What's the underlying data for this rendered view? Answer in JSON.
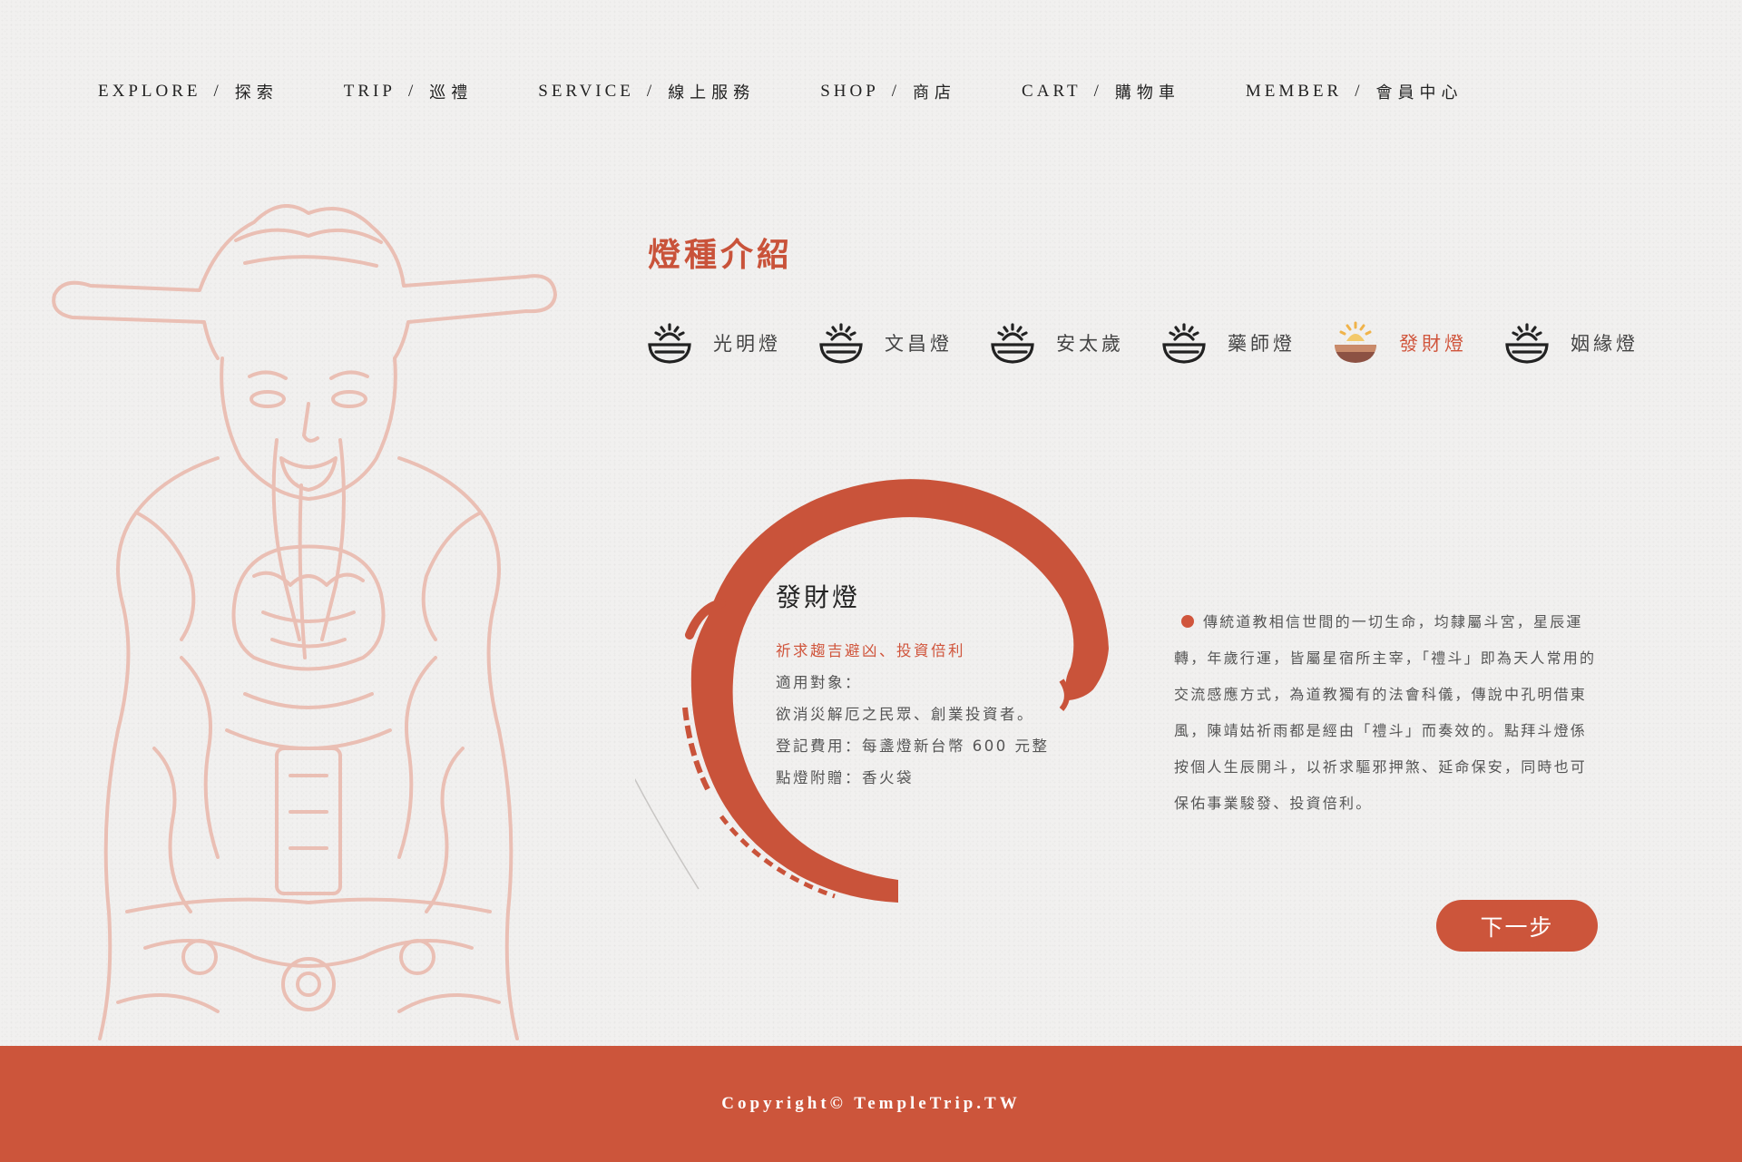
{
  "nav": [
    {
      "en": "EXPLORE",
      "zh": "探索"
    },
    {
      "en": "TRIP",
      "zh": "巡禮"
    },
    {
      "en": "SERVICE",
      "zh": "線上服務"
    },
    {
      "en": "SHOP",
      "zh": "商店"
    },
    {
      "en": "CART",
      "zh": "購物車"
    },
    {
      "en": "MEMBER",
      "zh": "會員中心"
    }
  ],
  "nav_separator": "/",
  "section_title": "燈種介紹",
  "lamp_tabs": [
    {
      "label": "光明燈",
      "icon": "lamp-bowl-icon",
      "active": false
    },
    {
      "label": "文昌燈",
      "icon": "lamp-bowl-icon",
      "active": false
    },
    {
      "label": "安太歲",
      "icon": "lamp-bowl-icon",
      "active": false
    },
    {
      "label": "藥師燈",
      "icon": "lamp-bowl-icon",
      "active": false
    },
    {
      "label": "發財燈",
      "icon": "lamp-bowl-filled-icon",
      "active": true
    },
    {
      "label": "姻緣燈",
      "icon": "lamp-bowl-icon",
      "active": false
    }
  ],
  "selected_lamp": {
    "name": "發財燈",
    "subtitle": "祈求趨吉避凶、投資倍利",
    "target_label": "適用對象：",
    "target": "欲消災解厄之民眾、創業投資者。",
    "fee": "登記費用：每盞燈新台幣 600 元整",
    "gift": "點燈附贈：香火袋"
  },
  "description": "傳統道教相信世間的一切生命，均隸屬斗宮，星辰運轉，年歲行運，皆屬星宿所主宰，「禮斗」即為天人常用的交流感應方式，為道教獨有的法會科儀，傳說中孔明借東風，陳靖姑祈雨都是經由「禮斗」而奏效的。點拜斗燈係按個人生辰開斗，以祈求驅邪押煞、延命保安，同時也可保佑事業駿發、投資倍利。",
  "next_button": "下一步",
  "footer": {
    "copyright": "Copyright© TempleTrip.TW"
  },
  "colors": {
    "accent": "#cc553b",
    "background": "#f1f0ef",
    "deity_line": "#e9b7aa"
  }
}
